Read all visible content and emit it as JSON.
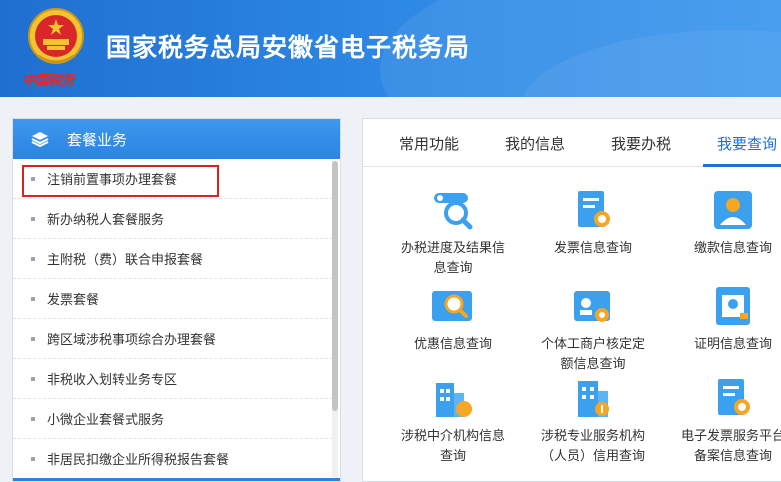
{
  "header": {
    "title": "国家税务总局安徽省电子税务局",
    "brand_script": "中国税务"
  },
  "sidebar": {
    "title": "套餐业务",
    "items": [
      "注销前置事项办理套餐",
      "新办纳税人套餐服务",
      "主附税（费）联合申报套餐",
      "发票套餐",
      "跨区域涉税事项综合办理套餐",
      "非税收入划转业务专区",
      "小微企业套餐式服务",
      "非居民扣缴企业所得税报告套餐"
    ]
  },
  "tabs": [
    "常用功能",
    "我的信息",
    "我要办税",
    "我要查询"
  ],
  "grid": [
    {
      "line1": "办税进度及结果信",
      "line2": "息查询",
      "icon": "search-progress-icon"
    },
    {
      "line1": "发票信息查询",
      "line2": "",
      "icon": "invoice-search-icon"
    },
    {
      "line1": "缴款信息查询",
      "line2": "",
      "icon": "payment-person-icon"
    },
    {
      "line1": "优惠信息查询",
      "line2": "",
      "icon": "discount-search-icon"
    },
    {
      "line1": "个体工商户核定定",
      "line2": "额信息查询",
      "icon": "id-card-search-icon"
    },
    {
      "line1": "证明信息查询",
      "line2": "",
      "icon": "certificate-icon"
    },
    {
      "line1": "涉税中介机构信息",
      "line2": "查询",
      "icon": "building-agency-icon"
    },
    {
      "line1": "涉税专业服务机构",
      "line2": "（人员）信用查询",
      "icon": "building-credit-icon"
    },
    {
      "line1": "电子发票服务平台",
      "line2": "备案信息查询",
      "icon": "einvoice-search-icon"
    }
  ],
  "colors": {
    "header_blue": "#1f6fd1",
    "accent": "#2b84e2",
    "highlight_red": "#d32525",
    "icon_orange": "#f5a623"
  }
}
